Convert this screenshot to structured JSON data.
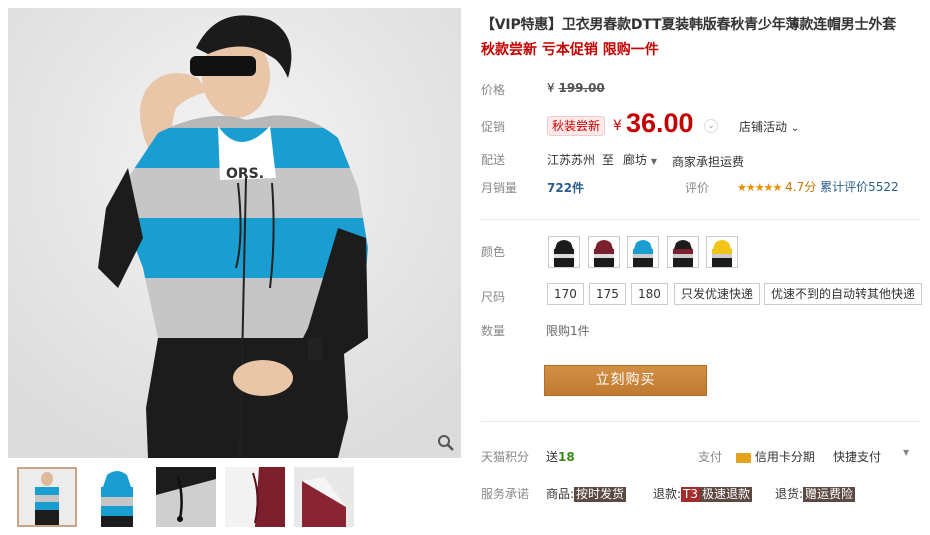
{
  "product": {
    "title": "【VIP特惠】卫衣男春款DTT夏装韩版春秋青少年薄款连帽男士外套",
    "subtitle": "秋款尝新 亏本促销 限购一件"
  },
  "price": {
    "label": "价格",
    "currency": "¥",
    "original": "199.00"
  },
  "promo": {
    "label": "促销",
    "tag": "秋装尝新",
    "currency": "¥",
    "price": "36.00",
    "store_activity": "店铺活动"
  },
  "shipping": {
    "label": "配送",
    "from": "江苏苏州",
    "to_word": "至",
    "to": "廊坊",
    "fee": "商家承担运费"
  },
  "sales": {
    "label": "月销量",
    "value": "722件",
    "review_label": "评价",
    "rating": "4.7分",
    "review_count": "累计评价5522",
    "stars": "★★★★★"
  },
  "colors": {
    "label": "颜色",
    "swatches": [
      "black-white",
      "burgundy",
      "blue",
      "black",
      "yellow"
    ]
  },
  "sizes": {
    "label": "尺码",
    "options": [
      "170",
      "175",
      "180",
      "只发优速快递",
      "优速不到的自动转其他快递"
    ]
  },
  "quantity": {
    "label": "数量",
    "limit": "限购1件"
  },
  "buy_button": "立刻购买",
  "points": {
    "label": "天猫积分",
    "prefix": "送",
    "value": "18",
    "pay_label": "支付",
    "credit": "信用卡分期",
    "fast_pay": "快捷支付"
  },
  "service": {
    "label": "服务承诺",
    "goods_label": "商品:",
    "goods_tag": "按时发货",
    "refund_label": "退款:",
    "refund_tag_a": "T3",
    "refund_tag_b": "极速退款",
    "return_label": "退货:",
    "return_tag": "赠运费险"
  },
  "colors_meta": {
    "accent_red": "#c40000",
    "buy_button": "#c8853a",
    "jacket_blue": "#1a9ed2",
    "jacket_gray": "#c6c6c6",
    "jacket_black": "#1c1c1c"
  }
}
